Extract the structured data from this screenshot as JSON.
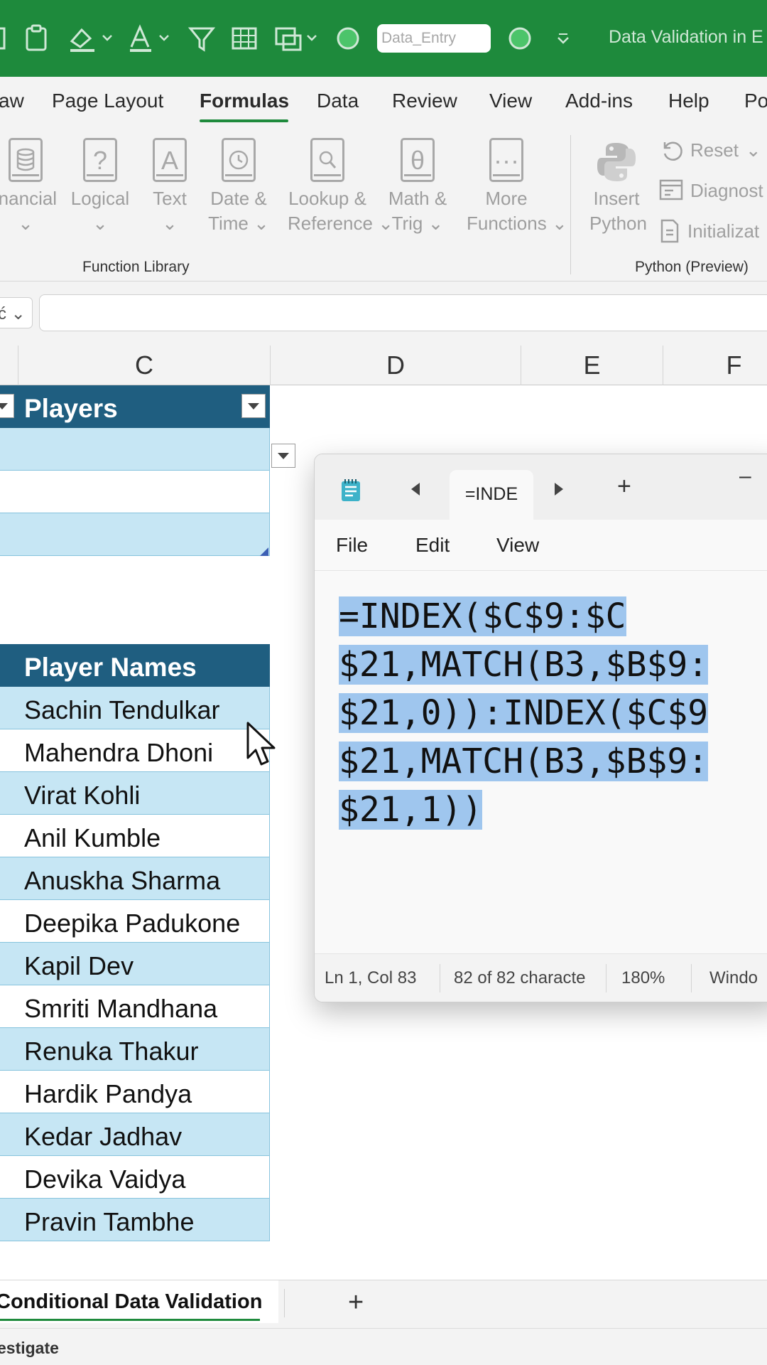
{
  "window": {
    "title": "Data Validation in E",
    "name_box_value": "Data_Entry"
  },
  "ribbon_tabs": [
    "aw",
    "Page Layout",
    "Formulas",
    "Data",
    "Review",
    "View",
    "Add-ins",
    "Help",
    "Po"
  ],
  "active_tab": "Formulas",
  "function_library": {
    "group_label": "Function Library",
    "items": [
      {
        "line1": "inancial",
        "line2": "",
        "icon": "financial-icon"
      },
      {
        "line1": "Logical",
        "line2": "",
        "icon": "logical-icon"
      },
      {
        "line1": "Text",
        "line2": "",
        "icon": "text-icon"
      },
      {
        "line1": "Date &",
        "line2": "Time",
        "icon": "date-time-icon"
      },
      {
        "line1": "Lookup &",
        "line2": "Reference",
        "icon": "lookup-icon"
      },
      {
        "line1": "Math &",
        "line2": "Trig",
        "icon": "math-trig-icon"
      },
      {
        "line1": "More",
        "line2": "Functions",
        "icon": "more-functions-icon"
      }
    ]
  },
  "python_group": {
    "group_label": "Python (Preview)",
    "insert_line1": "Insert",
    "insert_line2": "Python",
    "reset": "Reset",
    "diagnostics": "Diagnost",
    "initialization": "Initializat"
  },
  "formula_bar": {
    "name_box": "ć",
    "value": ""
  },
  "columns": [
    "C",
    "D",
    "E",
    "F"
  ],
  "top_table": {
    "header": "Players",
    "rows": [
      "",
      "",
      ""
    ]
  },
  "player_table": {
    "header": "Player Names",
    "rows": [
      "Sachin Tendulkar",
      "Mahendra Dhoni",
      "Virat Kohli",
      "Anil Kumble",
      "Anuskha Sharma",
      "Deepika Padukone",
      "Kapil Dev",
      "Smriti Mandhana",
      "Renuka Thakur",
      "Hardik Pandya",
      "Kedar Jadhav",
      "Devika Vaidya",
      "Pravin Tambhe"
    ]
  },
  "notepad": {
    "tab_title": "=INDE",
    "minimize": "–",
    "menu": [
      "File",
      "Edit",
      "View"
    ],
    "lines": [
      "=INDEX($C$9:$C",
      "$21,MATCH(B3,$B$9:",
      "$21,0)):INDEX($C$9",
      "$21,MATCH(B3,$B$9:",
      "$21,1))"
    ],
    "status": {
      "position": "Ln 1, Col 83",
      "chars": "82 of 82 characte",
      "zoom": "180%",
      "eol": "Windo"
    }
  },
  "sheet_tabs": [
    "Conditional Data Validation"
  ],
  "add_sheet": "+",
  "status_bar": "estigate",
  "colors": {
    "title_bar": "#1e8a3c",
    "table_header": "#1f5e80",
    "band_row": "#c6e6f4",
    "selection": "#9fc6ee"
  }
}
